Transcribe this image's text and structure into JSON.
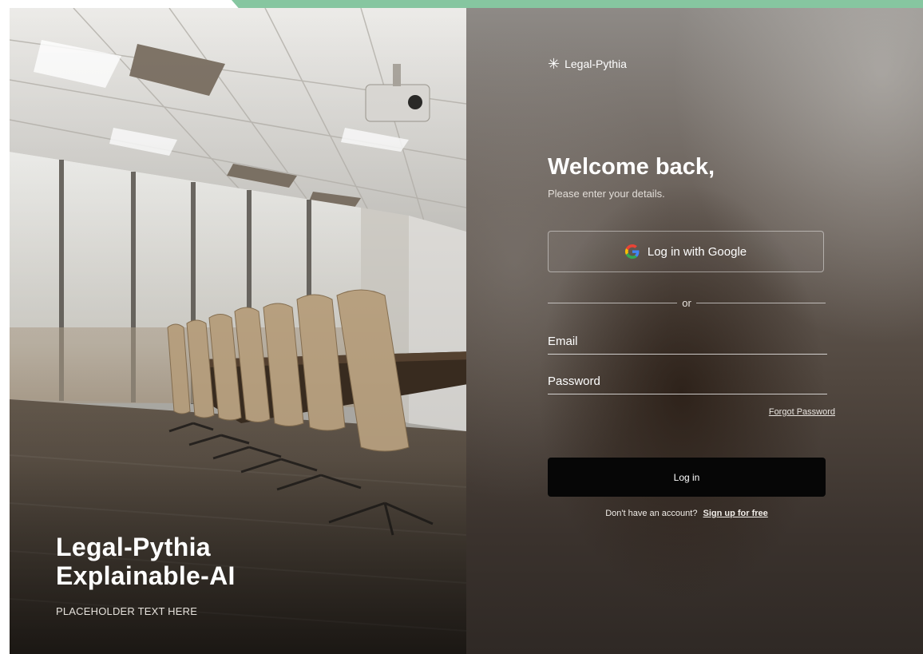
{
  "brand": {
    "name": "Legal-Pythia",
    "logo_icon": "asterisk-icon"
  },
  "hero": {
    "title_line1": "Legal-Pythia",
    "title_line2": "Explainable-AI",
    "subtitle": "PLACEHOLDER TEXT HERE",
    "image": "conference-room-photo"
  },
  "login": {
    "heading": "Welcome back,",
    "subheading": "Please enter your details.",
    "google_button_label": "Log in with Google",
    "google_icon": "google-icon",
    "divider_text": "or",
    "email_label": "Email",
    "password_label": "Password",
    "forgot_password_label": "Forgot Password",
    "login_button_label": "Log in",
    "signup_prompt": "Don't have an account?",
    "signup_link_label": "Sign up for free"
  },
  "colors": {
    "accent": "#86c6a0",
    "login_button": "#060606",
    "text": "#ffffff"
  }
}
